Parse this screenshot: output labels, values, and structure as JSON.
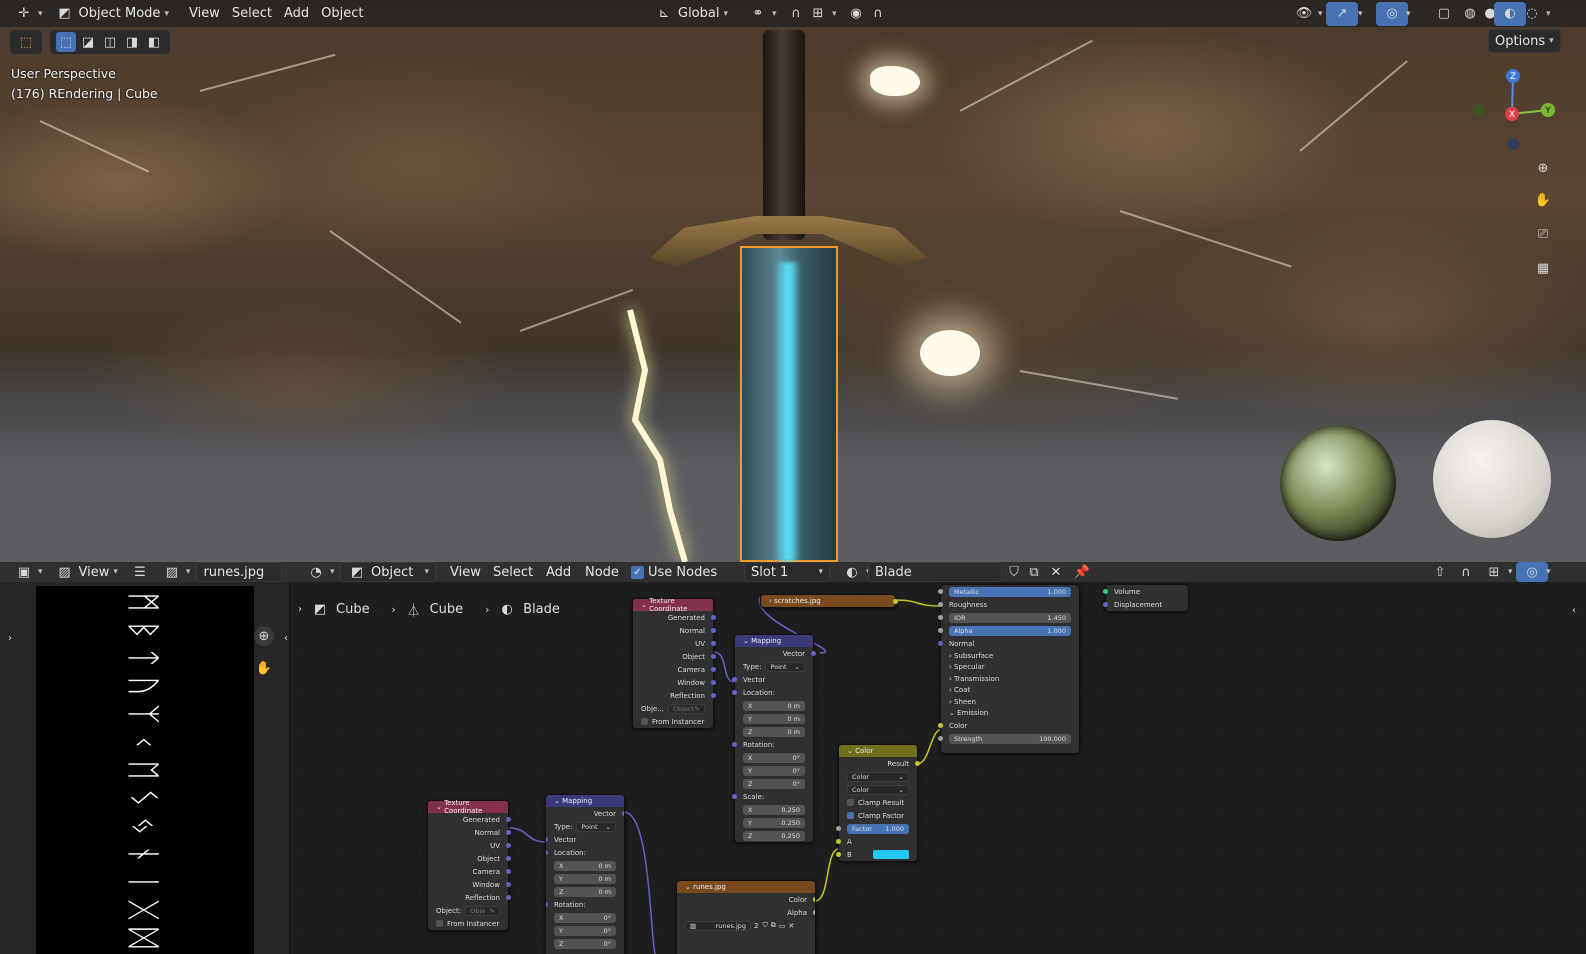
{
  "viewport": {
    "header": {
      "mode": "Object Mode",
      "menus": [
        "View",
        "Select",
        "Add",
        "Object"
      ],
      "transform": "Global",
      "options": "Options"
    },
    "overlay": {
      "line1": "User Perspective",
      "line2": "(176) REndering | Cube"
    },
    "gizmo": {
      "x": "X",
      "y": "Y",
      "z": "Z"
    }
  },
  "image_editor": {
    "view": "View",
    "image": "runes.jpg"
  },
  "node_editor": {
    "object": "Object",
    "menus": [
      "View",
      "Select",
      "Add",
      "Node"
    ],
    "use_nodes": "Use Nodes",
    "slot": "Slot 1",
    "material": "Blade",
    "breadcrumb": [
      "Cube",
      "Cube",
      "Blade"
    ]
  },
  "nodes": {
    "texcoord": {
      "title": "Texture Coordinate",
      "outputs": [
        "Generated",
        "Normal",
        "UV",
        "Object",
        "Camera",
        "Window",
        "Reflection"
      ],
      "object_label": "Obje...",
      "object_ph": "Object",
      "from_instancer": "From Instancer"
    },
    "texcoord2": {
      "title": "Texture Coordinate",
      "object_label": "Object:",
      "object_ph": "Obje"
    },
    "mapping": {
      "title": "Mapping",
      "vector": "Vector",
      "type_label": "Type:",
      "type": "Point",
      "location": "Location:",
      "rotation": "Rotation:",
      "scale": "Scale:",
      "loc": [
        "0 m",
        "0 m",
        "0 m"
      ],
      "rot": [
        "0°",
        "0°",
        "0°"
      ],
      "scl": [
        "0.250",
        "0.250",
        "0.250"
      ],
      "axes": [
        "X",
        "Y",
        "Z"
      ]
    },
    "scratches": {
      "title": "scratches.jpg"
    },
    "runes": {
      "title": "runes.jpg",
      "color": "Color",
      "alpha": "Alpha",
      "image": "runes.jpg",
      "users": "2"
    },
    "mix": {
      "title": "Color",
      "result": "Result",
      "sel1": "Color",
      "sel2": "Color",
      "clamp_result": "Clamp Result",
      "clamp_factor": "Clamp Factor",
      "factor_label": "Factor",
      "factor": "1.000",
      "a": "A",
      "b": "B",
      "b_color": "#22c8f2"
    },
    "bsdf": {
      "metallic": "Metallic",
      "metallic_v": "1.000",
      "roughness": "Roughness",
      "ior": "IOR",
      "ior_v": "1.450",
      "alpha": "Alpha",
      "alpha_v": "1.000",
      "normal": "Normal",
      "panels": [
        "Subsurface",
        "Specular",
        "Transmission",
        "Coat",
        "Sheen",
        "Emission"
      ],
      "color": "Color",
      "strength": "Strength",
      "strength_v": "100.000"
    },
    "output": {
      "volume": "Volume",
      "displacement": "Displacement"
    }
  },
  "runes_glyphs": [
    "ᛗ",
    "ᛒ",
    "ᛏ",
    "ᚢ",
    "ᛉ",
    "ᚲ",
    "ᛖ",
    "ᛊ",
    "ᛃ",
    "ᚾ",
    "ᛁ",
    "ᚷ",
    "ᛞ"
  ]
}
